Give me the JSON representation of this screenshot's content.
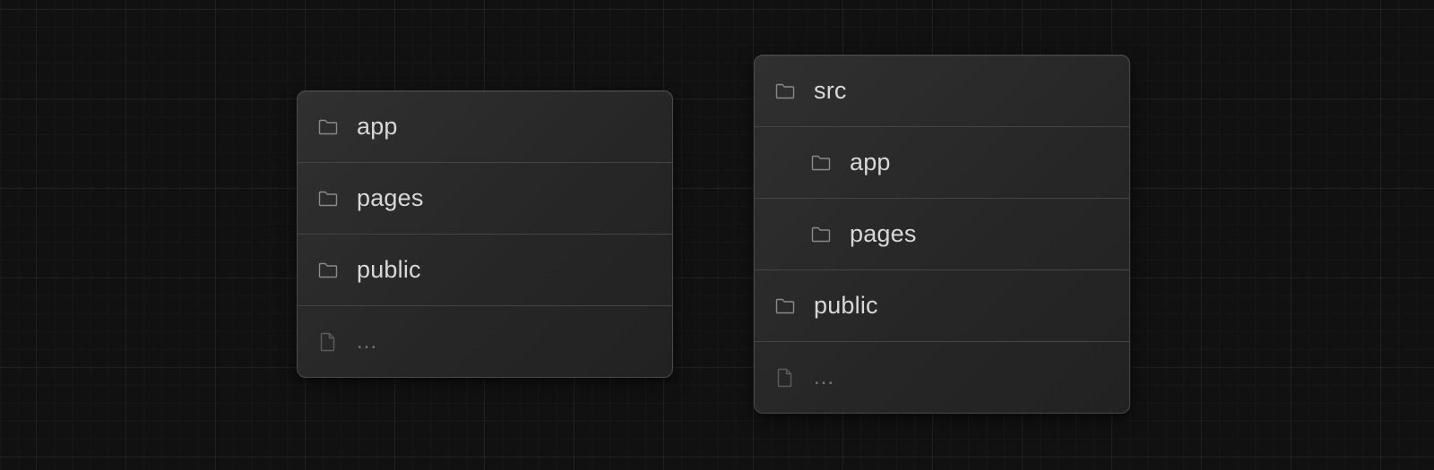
{
  "left_tree": {
    "items": [
      {
        "type": "folder",
        "label": "app"
      },
      {
        "type": "folder",
        "label": "pages"
      },
      {
        "type": "folder",
        "label": "public"
      },
      {
        "type": "file",
        "label": "..."
      }
    ]
  },
  "right_tree": {
    "items": [
      {
        "type": "folder",
        "label": "src",
        "depth": 0
      },
      {
        "type": "folder",
        "label": "app",
        "depth": 1
      },
      {
        "type": "folder",
        "label": "pages",
        "depth": 1
      },
      {
        "type": "folder",
        "label": "public",
        "depth": 0
      },
      {
        "type": "file",
        "label": "...",
        "depth": 0
      }
    ]
  },
  "icons": {
    "folder": "folder-icon",
    "file": "file-icon"
  },
  "colors": {
    "background": "#111111",
    "panel": "#2a2a2a",
    "text": "#d8d8d8",
    "muted_text": "#777777",
    "divider": "#444444"
  }
}
